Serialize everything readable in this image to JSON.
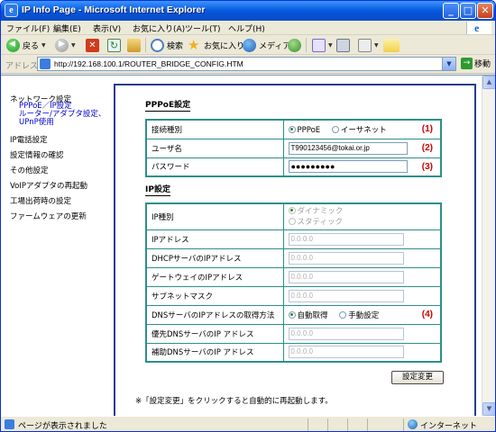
{
  "window": {
    "title": "IP Info Page - Microsoft Internet Explorer",
    "app_icon_glyph": "e",
    "min_glyph": "_",
    "max_glyph": "□",
    "close_glyph": "✕"
  },
  "menu": [
    "ファイル(F)",
    "編集(E)",
    "表示(V)",
    "お気に入り(A)",
    "ツール(T)",
    "ヘルプ(H)"
  ],
  "toolbar": {
    "back_label": "戻る",
    "search_label": "検索",
    "favorites_label": "お気に入り",
    "media_label": "メディア",
    "dropdown_glyph": "▼",
    "stop_glyph": "✕",
    "refresh_glyph": "↻",
    "star_glyph": "★"
  },
  "address": {
    "label": "アドレス(D)",
    "url": "http://192.168.100.1/ROUTER_BRIDGE_CONFIG.HTM",
    "go_label": "移動",
    "go_glyph": "→",
    "dropdown_glyph": "▼"
  },
  "nav": {
    "network_settings": "ネットワーク設定",
    "sub_pppoe": "PPPoE／IP設定",
    "sub_router": "ルーター/アダプタ設定、",
    "sub_upnp": "UPnP使用",
    "phone_settings": "IP電話設定",
    "confirm_settings": "設定情報の確認",
    "other_settings": "その他設定",
    "restart_adapter": "VoIPアダプタの再起動",
    "factory_reset": "工場出荷時の設定",
    "firmware_update": "ファームウェアの更新"
  },
  "pppoe_section": {
    "title": "PPPoE設定",
    "connection_type_label": "接続種別",
    "connection_options": [
      "PPPoE",
      "イーサネット"
    ],
    "connection_selected": "PPPoE",
    "username_label": "ユーザ名",
    "username_value": "T990123456@tokai.or.jp",
    "password_label": "パスワード",
    "password_value": "●●●●●●●●●",
    "annotations": [
      "(1)",
      "(2)",
      "(3)"
    ]
  },
  "ip_section": {
    "title": "IP設定",
    "ip_type_label": "IP種別",
    "ip_type_options": [
      "ダイナミック",
      "スタティック"
    ],
    "ip_type_selected": "ダイナミック",
    "ip_address_label": "IPアドレス",
    "dhcp_server_label": "DHCPサーバのIPアドレス",
    "gateway_label": "ゲートウェイのIPアドレス",
    "subnet_label": "サブネットマスク",
    "dns_method_label": "DNSサーバのIPアドレスの取得方法",
    "dns_method_options": [
      "自動取得",
      "手動設定"
    ],
    "dns_method_selected": "自動取得",
    "dns_method_annotation": "(4)",
    "primary_dns_label": "優先DNSサーバのIP アドレス",
    "secondary_dns_label": "補助DNSサーバのIP アドレス",
    "placeholder_ip": "0.0.0.0"
  },
  "apply_button": "設定変更",
  "note": "※「設定変更」をクリックすると自動的に再起動します。",
  "scrollbar": {
    "up_glyph": "▲",
    "down_glyph": "▼"
  },
  "status": {
    "text": "ページが表示されました",
    "zone": "インターネット"
  }
}
